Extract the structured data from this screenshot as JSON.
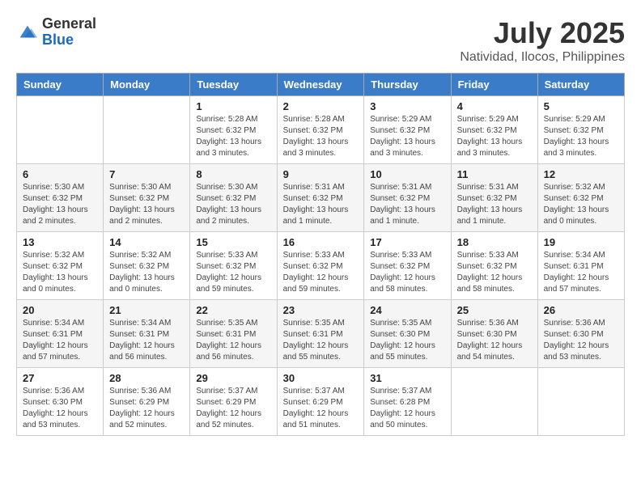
{
  "header": {
    "logo_general": "General",
    "logo_blue": "Blue",
    "main_title": "July 2025",
    "subtitle": "Natividad, Ilocos, Philippines"
  },
  "days_of_week": [
    "Sunday",
    "Monday",
    "Tuesday",
    "Wednesday",
    "Thursday",
    "Friday",
    "Saturday"
  ],
  "weeks": [
    [
      {
        "day": "",
        "info": ""
      },
      {
        "day": "",
        "info": ""
      },
      {
        "day": "1",
        "info": "Sunrise: 5:28 AM\nSunset: 6:32 PM\nDaylight: 13 hours and 3 minutes."
      },
      {
        "day": "2",
        "info": "Sunrise: 5:28 AM\nSunset: 6:32 PM\nDaylight: 13 hours and 3 minutes."
      },
      {
        "day": "3",
        "info": "Sunrise: 5:29 AM\nSunset: 6:32 PM\nDaylight: 13 hours and 3 minutes."
      },
      {
        "day": "4",
        "info": "Sunrise: 5:29 AM\nSunset: 6:32 PM\nDaylight: 13 hours and 3 minutes."
      },
      {
        "day": "5",
        "info": "Sunrise: 5:29 AM\nSunset: 6:32 PM\nDaylight: 13 hours and 3 minutes."
      }
    ],
    [
      {
        "day": "6",
        "info": "Sunrise: 5:30 AM\nSunset: 6:32 PM\nDaylight: 13 hours and 2 minutes."
      },
      {
        "day": "7",
        "info": "Sunrise: 5:30 AM\nSunset: 6:32 PM\nDaylight: 13 hours and 2 minutes."
      },
      {
        "day": "8",
        "info": "Sunrise: 5:30 AM\nSunset: 6:32 PM\nDaylight: 13 hours and 2 minutes."
      },
      {
        "day": "9",
        "info": "Sunrise: 5:31 AM\nSunset: 6:32 PM\nDaylight: 13 hours and 1 minute."
      },
      {
        "day": "10",
        "info": "Sunrise: 5:31 AM\nSunset: 6:32 PM\nDaylight: 13 hours and 1 minute."
      },
      {
        "day": "11",
        "info": "Sunrise: 5:31 AM\nSunset: 6:32 PM\nDaylight: 13 hours and 1 minute."
      },
      {
        "day": "12",
        "info": "Sunrise: 5:32 AM\nSunset: 6:32 PM\nDaylight: 13 hours and 0 minutes."
      }
    ],
    [
      {
        "day": "13",
        "info": "Sunrise: 5:32 AM\nSunset: 6:32 PM\nDaylight: 13 hours and 0 minutes."
      },
      {
        "day": "14",
        "info": "Sunrise: 5:32 AM\nSunset: 6:32 PM\nDaylight: 13 hours and 0 minutes."
      },
      {
        "day": "15",
        "info": "Sunrise: 5:33 AM\nSunset: 6:32 PM\nDaylight: 12 hours and 59 minutes."
      },
      {
        "day": "16",
        "info": "Sunrise: 5:33 AM\nSunset: 6:32 PM\nDaylight: 12 hours and 59 minutes."
      },
      {
        "day": "17",
        "info": "Sunrise: 5:33 AM\nSunset: 6:32 PM\nDaylight: 12 hours and 58 minutes."
      },
      {
        "day": "18",
        "info": "Sunrise: 5:33 AM\nSunset: 6:32 PM\nDaylight: 12 hours and 58 minutes."
      },
      {
        "day": "19",
        "info": "Sunrise: 5:34 AM\nSunset: 6:31 PM\nDaylight: 12 hours and 57 minutes."
      }
    ],
    [
      {
        "day": "20",
        "info": "Sunrise: 5:34 AM\nSunset: 6:31 PM\nDaylight: 12 hours and 57 minutes."
      },
      {
        "day": "21",
        "info": "Sunrise: 5:34 AM\nSunset: 6:31 PM\nDaylight: 12 hours and 56 minutes."
      },
      {
        "day": "22",
        "info": "Sunrise: 5:35 AM\nSunset: 6:31 PM\nDaylight: 12 hours and 56 minutes."
      },
      {
        "day": "23",
        "info": "Sunrise: 5:35 AM\nSunset: 6:31 PM\nDaylight: 12 hours and 55 minutes."
      },
      {
        "day": "24",
        "info": "Sunrise: 5:35 AM\nSunset: 6:30 PM\nDaylight: 12 hours and 55 minutes."
      },
      {
        "day": "25",
        "info": "Sunrise: 5:36 AM\nSunset: 6:30 PM\nDaylight: 12 hours and 54 minutes."
      },
      {
        "day": "26",
        "info": "Sunrise: 5:36 AM\nSunset: 6:30 PM\nDaylight: 12 hours and 53 minutes."
      }
    ],
    [
      {
        "day": "27",
        "info": "Sunrise: 5:36 AM\nSunset: 6:30 PM\nDaylight: 12 hours and 53 minutes."
      },
      {
        "day": "28",
        "info": "Sunrise: 5:36 AM\nSunset: 6:29 PM\nDaylight: 12 hours and 52 minutes."
      },
      {
        "day": "29",
        "info": "Sunrise: 5:37 AM\nSunset: 6:29 PM\nDaylight: 12 hours and 52 minutes."
      },
      {
        "day": "30",
        "info": "Sunrise: 5:37 AM\nSunset: 6:29 PM\nDaylight: 12 hours and 51 minutes."
      },
      {
        "day": "31",
        "info": "Sunrise: 5:37 AM\nSunset: 6:28 PM\nDaylight: 12 hours and 50 minutes."
      },
      {
        "day": "",
        "info": ""
      },
      {
        "day": "",
        "info": ""
      }
    ]
  ]
}
